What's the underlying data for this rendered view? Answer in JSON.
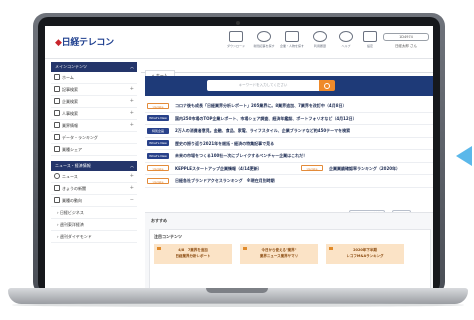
{
  "header": {
    "logo": "日経テレコン",
    "icons": [
      {
        "name": "download-icon",
        "label": "ダウンロード"
      },
      {
        "name": "news-search-icon",
        "label": "新聞記事を探す"
      },
      {
        "name": "company-search-icon",
        "label": "企業・人物を探す"
      },
      {
        "name": "history-icon",
        "label": "利用履歴"
      },
      {
        "name": "help-icon",
        "label": "ヘルプ"
      },
      {
        "name": "settings-icon",
        "label": "設定"
      }
    ],
    "user_id": "1D4974",
    "user_name": "日経太郎 さん"
  },
  "sidebar": {
    "menu_title": "メインコンテンツ",
    "items": [
      {
        "label": "ホーム"
      },
      {
        "label": "記事検索"
      },
      {
        "label": "企業検索"
      },
      {
        "label": "人事検索"
      },
      {
        "label": "業界情報"
      },
      {
        "label": "データ・ランキング"
      },
      {
        "label": "業種シェア"
      }
    ],
    "news_title": "ニュース・経済情報",
    "news_items": [
      {
        "label": "ニュース"
      },
      {
        "label": "きょうの新聞"
      },
      {
        "label": "業種の動向"
      },
      {
        "label": "日経ビジネス"
      },
      {
        "label": "週刊東洋経済"
      },
      {
        "label": "週刊ダイヤモンド"
      }
    ]
  },
  "main": {
    "tab_label": "ホーム",
    "search_placeholder": "キーワードを入力してください",
    "news": [
      {
        "badge": "Update",
        "badge_type": "upd",
        "text": "コロナ後も成長「日経業界分析レポート」205業界に。8業界追加、7業界を改訂中（4月8日）"
      },
      {
        "badge": "What's New",
        "badge_type": "wn",
        "text": "国内250市場のTOP企業レポート、市場シェア調査、経済年鑑誌、ポートフォリオなど（4月12日）"
      },
      {
        "badge": "特別企画",
        "badge_type": "wn",
        "text": "2万人の消費者意見。金融、食品、家電、ライフスタイル、企業ブランドなど約450テーマを検索"
      },
      {
        "badge": "What's New",
        "badge_type": "wn",
        "text": "歴史の振り返り2021年を総括・経済の特集記事で見る"
      },
      {
        "badge": "What's New",
        "badge_type": "wn",
        "text": "未来の市場をつくる100社—次にブレイクするベンチャー企業はこれだ！"
      },
      {
        "badge": "Update",
        "badge_type": "upd",
        "text": "KEPPLEスタートアップ企業情報（4/14更新）",
        "badge2": "Update",
        "text2": "企業業績確認率ランキング（2020年）"
      },
      {
        "badge": "Update",
        "badge_type": "upd",
        "text": "日経各社ブランドアクセスランキング　※現在月別時期"
      }
    ],
    "actions": {
      "customize": "コンテンツを編集",
      "print": "印刷"
    },
    "recommend_title": "おすすめ",
    "recommend_panel": "注目コンテンツ",
    "cards": [
      {
        "line1": "4/8　7業界を追加",
        "line2": "日経業界分析レポート"
      },
      {
        "line1": "今日から使える\"業界\"",
        "line2": "業界ニュース業界サマリ"
      },
      {
        "line1": "2020年下半期",
        "line2": "レコフM&Aランキング"
      }
    ]
  }
}
